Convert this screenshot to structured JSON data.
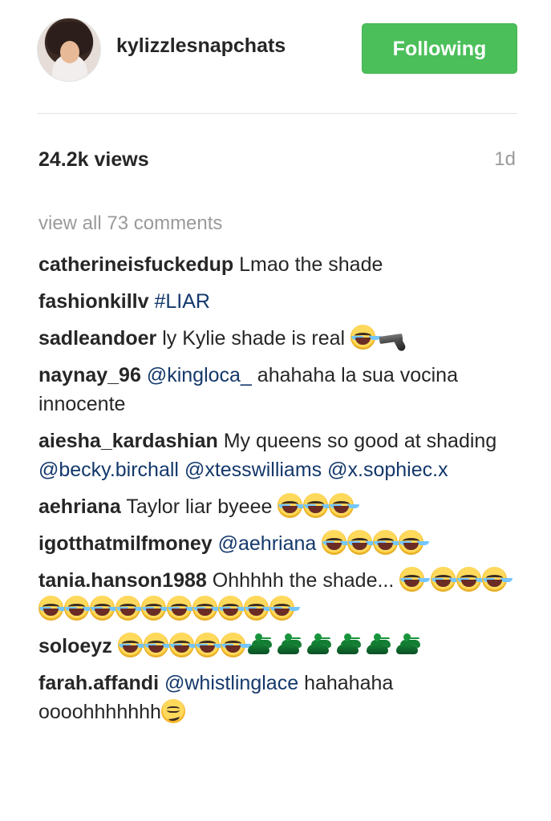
{
  "header": {
    "username": "kylizzlesnapchats",
    "follow_button": "Following"
  },
  "stats": {
    "views": "24.2k views",
    "timestamp": "1d"
  },
  "comments_section": {
    "view_all": "view all 73 comments",
    "comments": [
      {
        "user": "catherineisfuckedup",
        "text": "Lmao the shade"
      },
      {
        "user": "fashionkillv",
        "mention": "#LIAR"
      },
      {
        "user": "sadleandoer",
        "text": "ly Kylie shade is real"
      },
      {
        "user": "naynay_96",
        "mention": "@kingloca_",
        "text": "ahahaha la sua vocina innocente"
      },
      {
        "user": "aiesha_kardashian",
        "text": "My queens so good at shading",
        "mentions": [
          "@becky.birchall",
          "@xtesswilliams",
          "@x.sophiec.x"
        ]
      },
      {
        "user": "aehriana",
        "text": "Taylor liar byeee"
      },
      {
        "user": "igotthatmilfmoney",
        "mention": "@aehriana"
      },
      {
        "user": "tania.hanson1988",
        "text": "Ohhhhh the shade..."
      },
      {
        "user": "soloeyz"
      },
      {
        "user": "farah.affandi",
        "mention": "@whistlinglace",
        "text": "hahahaha oooohhhhhhh"
      }
    ]
  },
  "emoji_names": {
    "laugh": "face-with-tears-of-joy-icon",
    "gun": "pistol-icon",
    "poop": "pile-of-poo-icon",
    "smirk": "smirking-face-icon"
  },
  "colors": {
    "follow_button": "#4bbf5a",
    "mention": "#14386b",
    "muted_text": "#9a9a9a"
  }
}
